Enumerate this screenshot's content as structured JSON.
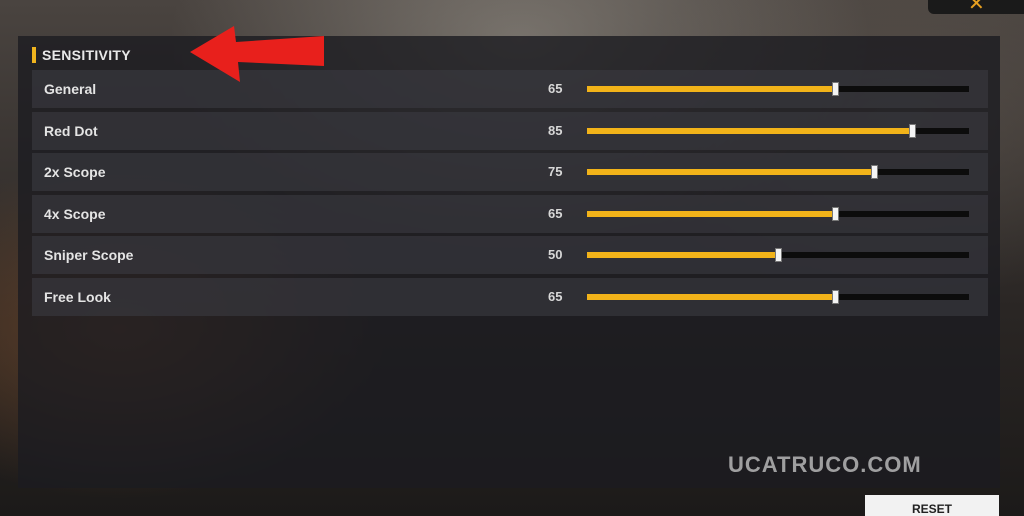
{
  "section": {
    "title": "SENSITIVITY"
  },
  "settings": [
    {
      "label": "General",
      "value": "65",
      "level": 65
    },
    {
      "label": "Red Dot",
      "value": "85",
      "level": 85
    },
    {
      "label": "2x Scope",
      "value": "75",
      "level": 75
    },
    {
      "label": "4x Scope",
      "value": "65",
      "level": 65
    },
    {
      "label": "Sniper Scope",
      "value": "50",
      "level": 50
    },
    {
      "label": "Free Look",
      "value": "65",
      "level": 65
    }
  ],
  "slider_max": 100,
  "watermark": "UCATRUCO.COM",
  "reset_label": "RESET",
  "close_icon": "close-icon",
  "colors": {
    "accent": "#f2b319",
    "annotation_arrow": "#e8201c"
  }
}
